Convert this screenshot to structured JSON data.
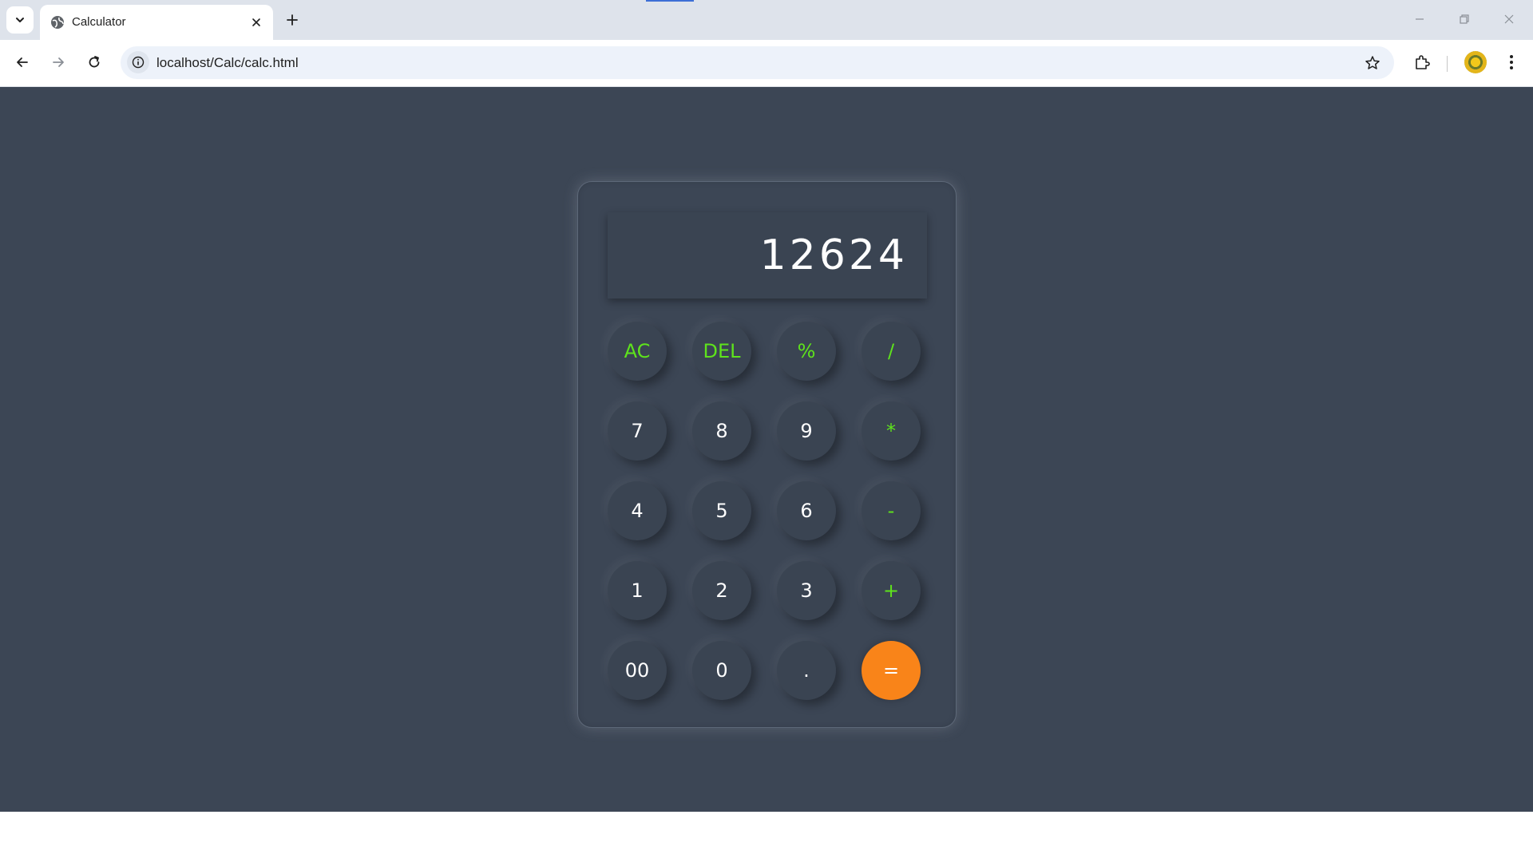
{
  "browser": {
    "tab_title": "Calculator",
    "url": "localhost/Calc/calc.html"
  },
  "calculator": {
    "display": "12624",
    "keys": [
      {
        "label": "AC",
        "kind": "op"
      },
      {
        "label": "DEL",
        "kind": "op"
      },
      {
        "label": "%",
        "kind": "op"
      },
      {
        "label": "/",
        "kind": "op"
      },
      {
        "label": "7",
        "kind": "num"
      },
      {
        "label": "8",
        "kind": "num"
      },
      {
        "label": "9",
        "kind": "num"
      },
      {
        "label": "*",
        "kind": "op"
      },
      {
        "label": "4",
        "kind": "num"
      },
      {
        "label": "5",
        "kind": "num"
      },
      {
        "label": "6",
        "kind": "num"
      },
      {
        "label": "-",
        "kind": "op"
      },
      {
        "label": "1",
        "kind": "num"
      },
      {
        "label": "2",
        "kind": "num"
      },
      {
        "label": "3",
        "kind": "num"
      },
      {
        "label": "+",
        "kind": "op"
      },
      {
        "label": "00",
        "kind": "num"
      },
      {
        "label": "0",
        "kind": "num"
      },
      {
        "label": ".",
        "kind": "num"
      },
      {
        "label": "=",
        "kind": "equals"
      }
    ]
  },
  "colors": {
    "page_background": "#3c4655",
    "operator_text": "#5ee31c",
    "equals_button": "#f98419"
  },
  "icons": {
    "tab_search": "chevron-down-icon",
    "favicon": "globe-icon",
    "close": "close-icon",
    "new_tab": "plus-icon",
    "back": "arrow-left-icon",
    "forward": "arrow-right-icon",
    "reload": "reload-icon",
    "site_info": "info-icon",
    "bookmark": "star-icon",
    "extensions": "puzzle-icon",
    "menu": "kebab-menu-icon"
  }
}
